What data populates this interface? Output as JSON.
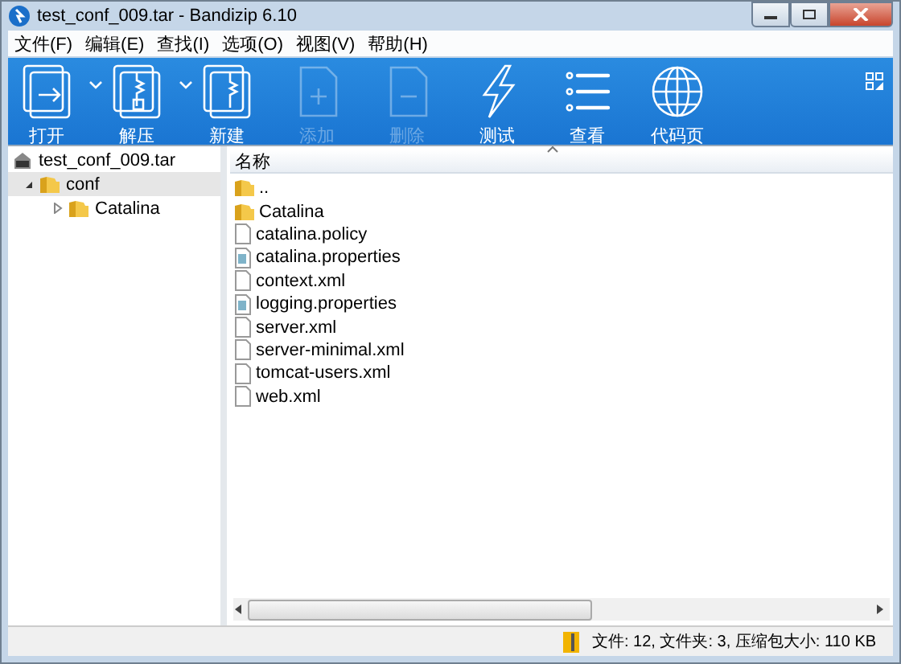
{
  "window": {
    "title": "test_conf_009.tar - Bandizip 6.10"
  },
  "menu": [
    "文件(F)",
    "编辑(E)",
    "查找(I)",
    "选项(O)",
    "视图(V)",
    "帮助(H)"
  ],
  "toolbar": [
    {
      "kind": "open",
      "label": "打开",
      "disabled": false,
      "has_menu": true
    },
    {
      "kind": "extract",
      "label": "解压",
      "disabled": false,
      "has_menu": true
    },
    {
      "kind": "new",
      "label": "新建",
      "disabled": false,
      "has_menu": false
    },
    {
      "kind": "add",
      "label": "添加",
      "disabled": true,
      "has_menu": false
    },
    {
      "kind": "delete",
      "label": "删除",
      "disabled": true,
      "has_menu": false
    },
    {
      "kind": "test",
      "label": "测试",
      "disabled": false,
      "has_menu": false
    },
    {
      "kind": "view",
      "label": "查看",
      "disabled": false,
      "has_menu": false
    },
    {
      "kind": "codepage",
      "label": "代码页",
      "disabled": false,
      "has_menu": false
    }
  ],
  "tree": {
    "label": "test_conf_009.tar",
    "children": [
      {
        "label": "conf",
        "selected": true,
        "expanded": true,
        "children": [
          {
            "label": "Catalina",
            "selected": false,
            "expanded": false
          }
        ]
      }
    ]
  },
  "file_list": {
    "columns": [
      "名称"
    ],
    "rows": [
      {
        "kind": "folder",
        "name": ".."
      },
      {
        "kind": "folder",
        "name": "Catalina"
      },
      {
        "kind": "file",
        "name": "catalina.policy"
      },
      {
        "kind": "config",
        "name": "catalina.properties"
      },
      {
        "kind": "file",
        "name": "context.xml"
      },
      {
        "kind": "config",
        "name": "logging.properties"
      },
      {
        "kind": "file",
        "name": "server.xml"
      },
      {
        "kind": "file",
        "name": "server-minimal.xml"
      },
      {
        "kind": "file",
        "name": "tomcat-users.xml"
      },
      {
        "kind": "file",
        "name": "web.xml"
      }
    ]
  },
  "status_bar": {
    "text": "文件: 12, 文件夹: 3, 压缩包大小: 110 KB"
  }
}
